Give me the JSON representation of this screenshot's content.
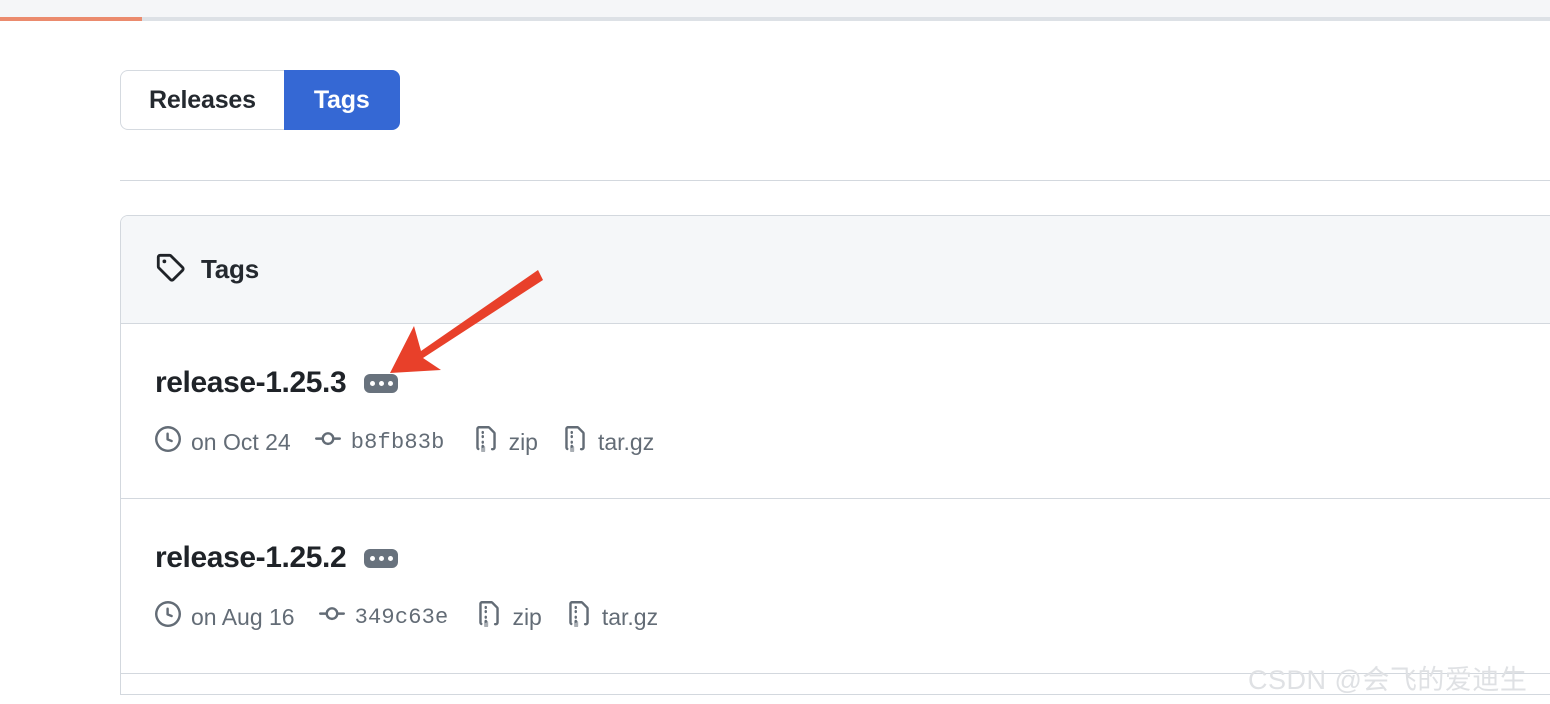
{
  "browser": {
    "progress_percent": 9,
    "progress_color": "#eb8b6e",
    "strip_color": "#f5f6f8"
  },
  "tabs": {
    "active": "Tags",
    "accent_color": "#3568d4",
    "items": [
      {
        "label": "Releases",
        "icon": "releases-tab",
        "active": false
      },
      {
        "label": "Tags",
        "icon": "tags-tab",
        "active": true
      }
    ]
  },
  "card": {
    "header": {
      "icon": "tag-icon",
      "title": "Tags"
    },
    "rows": [
      {
        "name": "release-1.25.3",
        "menu_icon": "kebab-dots-icon",
        "date_icon": "clock-icon",
        "date": "on Oct 24",
        "commit_icon": "git-commit-icon",
        "commit": "b8fb83b",
        "zip_icon": "file-zip-icon",
        "zip_label": "zip",
        "targz_icon": "file-zip-icon",
        "targz_label": "tar.gz"
      },
      {
        "name": "release-1.25.2",
        "menu_icon": "kebab-dots-icon",
        "date_icon": "clock-icon",
        "date": "on Aug 16",
        "commit_icon": "git-commit-icon",
        "commit": "349c63e",
        "zip_icon": "file-zip-icon",
        "zip_label": "zip",
        "targz_icon": "file-zip-icon",
        "targz_label": "tar.gz"
      }
    ]
  },
  "annotation": {
    "arrow_icon": "red-arrow-icon",
    "arrow_color": "#e8402a",
    "points_to": "release-1.25.3"
  },
  "watermark": {
    "text": "CSDN @会飞的爱迪生"
  }
}
